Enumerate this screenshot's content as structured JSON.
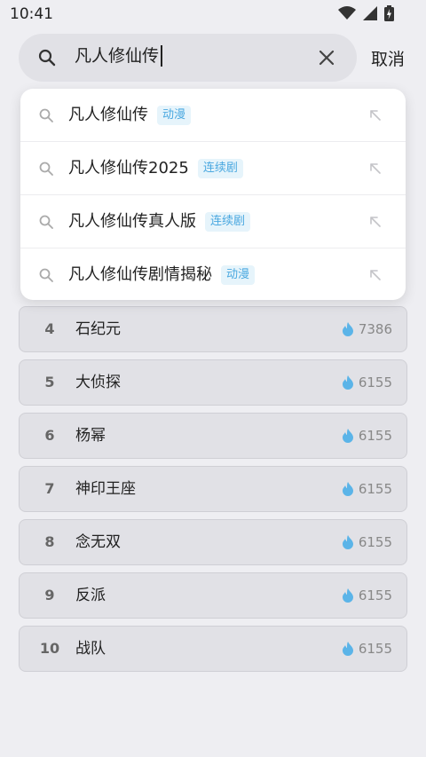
{
  "status": {
    "time": "10:41"
  },
  "search": {
    "query": "凡人修仙传",
    "cancel_label": "取消"
  },
  "suggestions": [
    {
      "text": "凡人修仙传",
      "tag": "动漫"
    },
    {
      "text": "凡人修仙传2025",
      "tag": "连续剧"
    },
    {
      "text": "凡人修仙传真人版",
      "tag": "连续剧"
    },
    {
      "text": "凡人修仙传剧情揭秘",
      "tag": "动漫"
    }
  ],
  "ranking": [
    {
      "rank": "4",
      "title": "石纪元",
      "heat": "7386"
    },
    {
      "rank": "5",
      "title": "大侦探",
      "heat": "6155"
    },
    {
      "rank": "6",
      "title": "杨幂",
      "heat": "6155"
    },
    {
      "rank": "7",
      "title": "神印王座",
      "heat": "6155"
    },
    {
      "rank": "8",
      "title": "念无双",
      "heat": "6155"
    },
    {
      "rank": "9",
      "title": "反派",
      "heat": "6155"
    },
    {
      "rank": "10",
      "title": "战队",
      "heat": "6155"
    }
  ],
  "colors": {
    "accent": "#4aa8e0",
    "flame": "#5bb4e8",
    "background": "#eeeef2"
  }
}
